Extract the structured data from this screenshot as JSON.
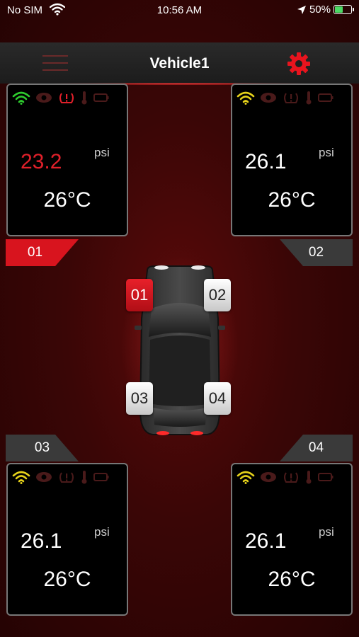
{
  "status_bar": {
    "carrier": "No SIM",
    "time": "10:56 AM",
    "battery_percent": "50%",
    "battery_level": 0.5
  },
  "nav": {
    "title": "Vehicle1",
    "menu_icon": "hamburger-menu-icon",
    "settings_icon": "gear-icon"
  },
  "tires": [
    {
      "id": "01",
      "pressure": "23.2",
      "unit": "psi",
      "temperature": "26°C",
      "signal_color": "#2ecc2e",
      "alert": true
    },
    {
      "id": "02",
      "pressure": "26.1",
      "unit": "psi",
      "temperature": "26°C",
      "signal_color": "#e6d21a",
      "alert": false
    },
    {
      "id": "03",
      "pressure": "26.1",
      "unit": "psi",
      "temperature": "26°C",
      "signal_color": "#e6d21a",
      "alert": false
    },
    {
      "id": "04",
      "pressure": "26.1",
      "unit": "psi",
      "temperature": "26°C",
      "signal_color": "#e6d21a",
      "alert": false
    }
  ],
  "car_badges": [
    "01",
    "02",
    "03",
    "04"
  ],
  "colors": {
    "accent_red": "#d8141e",
    "alert_red": "#e0202a",
    "inactive_icon": "#4a1a1a"
  }
}
